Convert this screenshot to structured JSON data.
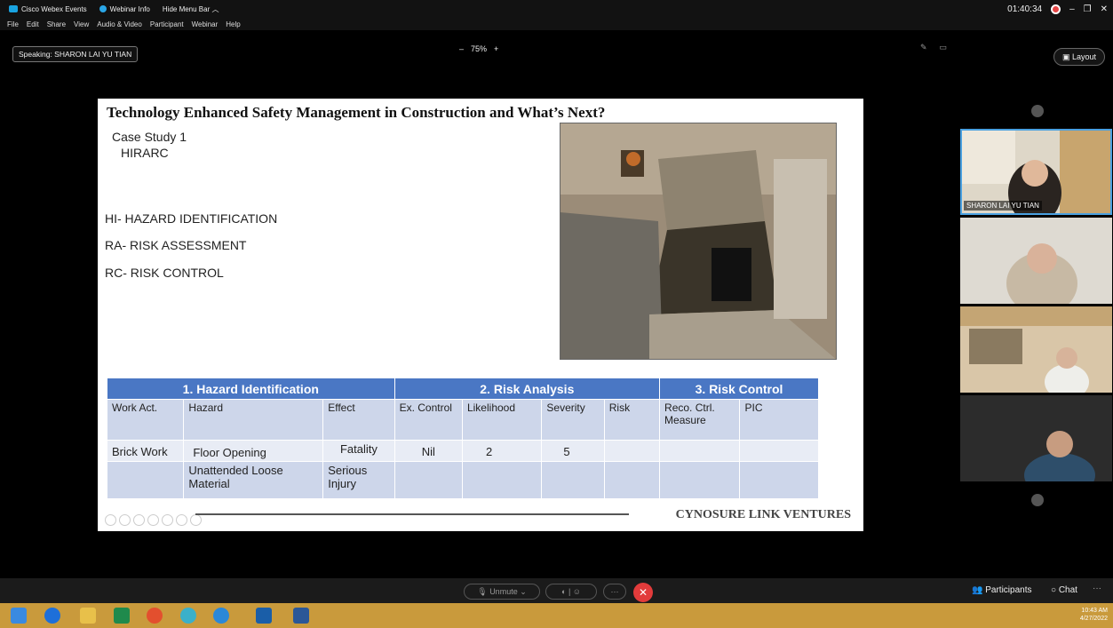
{
  "titlebar": {
    "app_name": "Cisco Webex Events",
    "info_label": "Webinar Info",
    "hide_menu": "Hide Menu Bar",
    "time": "01:40:34",
    "minimize": "–",
    "restore": "❐",
    "close": "✕"
  },
  "menu": [
    "File",
    "Edit",
    "Share",
    "View",
    "Audio & Video",
    "Participant",
    "Webinar",
    "Help"
  ],
  "speaking": "Speaking: SHARON LAI YU TIAN",
  "zoom": {
    "minus": "–",
    "level": "75%",
    "plus": "+"
  },
  "layout_button": "Layout",
  "slide": {
    "title": "Technology Enhanced Safety Management in Construction and What’s Next?",
    "case_study": "Case Study 1",
    "hirarc": "HIRARC",
    "hi": "HI- HAZARD IDENTIFICATION",
    "ra": "RA- RISK ASSESSMENT",
    "rc": "RC- RISK CONTROL",
    "footer": "CYNOSURE LINK VENTURES",
    "table": {
      "groups": [
        "1. Hazard Identification",
        "2. Risk Analysis",
        "3. Risk Control"
      ],
      "columns": [
        "Work Act.",
        "Hazard",
        "Effect",
        "Ex. Control",
        "Likelihood",
        "Severity",
        "Risk",
        "Reco. Ctrl. Measure",
        "PIC"
      ],
      "rows": [
        [
          "Brick Work",
          "Floor Opening",
          "Fatality",
          "Nil",
          "2",
          "5",
          "",
          "",
          ""
        ],
        [
          "",
          "Unattended Loose Material",
          "Serious Injury",
          "",
          "",
          "",
          "",
          "",
          ""
        ]
      ]
    }
  },
  "participants": [
    {
      "name": "SHARON LAI YU TIAN"
    }
  ],
  "callbar": {
    "unmute": "Unmute",
    "participants": "Participants",
    "chat": "Chat",
    "more": "···"
  },
  "tray": {
    "time": "10:43 AM",
    "date": "4/27/2022"
  }
}
